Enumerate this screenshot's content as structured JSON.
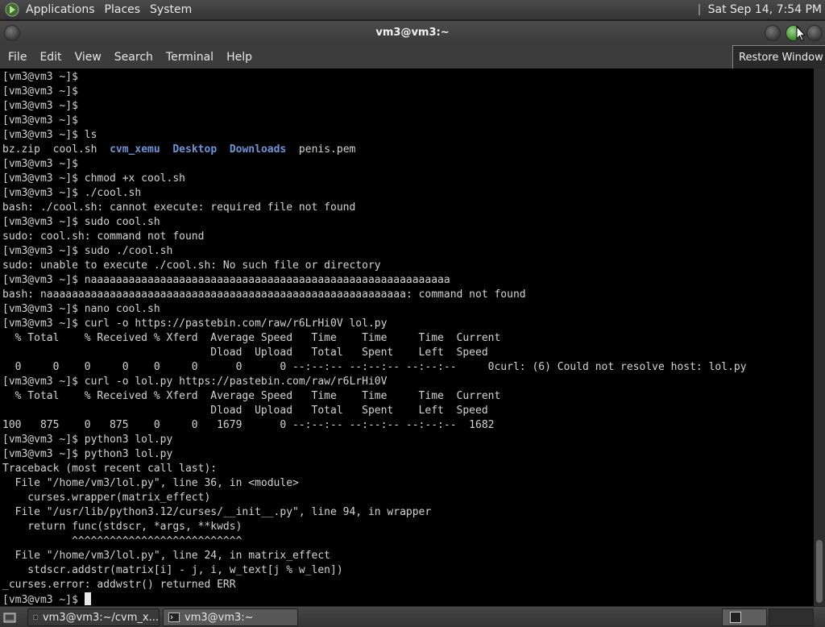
{
  "top_panel": {
    "menus": [
      "Applications",
      "Places",
      "System"
    ],
    "clock": "Sat Sep 14,  7:54 PM"
  },
  "window": {
    "title": "vm3@vm3:~",
    "tooltip": "Restore Window"
  },
  "menubar": [
    "File",
    "Edit",
    "View",
    "Search",
    "Terminal",
    "Help"
  ],
  "terminal": {
    "lines": [
      "[vm3@vm3 ~]$",
      "[vm3@vm3 ~]$",
      "[vm3@vm3 ~]$",
      "[vm3@vm3 ~]$",
      "[vm3@vm3 ~]$ ls",
      "__LS__",
      "[vm3@vm3 ~]$",
      "[vm3@vm3 ~]$ chmod +x cool.sh",
      "[vm3@vm3 ~]$ ./cool.sh",
      "bash: ./cool.sh: cannot execute: required file not found",
      "[vm3@vm3 ~]$ sudo cool.sh",
      "sudo: cool.sh: command not found",
      "[vm3@vm3 ~]$ sudo ./cool.sh",
      "sudo: unable to execute ./cool.sh: No such file or directory",
      "[vm3@vm3 ~]$ naaaaaaaaaaaaaaaaaaaaaaaaaaaaaaaaaaaaaaaaaaaaaaaaaaaaaaaaa",
      "bash: naaaaaaaaaaaaaaaaaaaaaaaaaaaaaaaaaaaaaaaaaaaaaaaaaaaaaaaaa: command not found",
      "[vm3@vm3 ~]$ nano cool.sh",
      "[vm3@vm3 ~]$ curl -o https://pastebin.com/raw/r6LrHi0V lol.py",
      "  % Total    % Received % Xferd  Average Speed   Time    Time     Time  Current",
      "                                 Dload  Upload   Total   Spent    Left  Speed",
      "  0     0    0     0    0     0      0      0 --:--:-- --:--:-- --:--:--     0curl: (6) Could not resolve host: lol.py",
      "[vm3@vm3 ~]$ curl -o lol.py https://pastebin.com/raw/r6LrHi0V",
      "  % Total    % Received % Xferd  Average Speed   Time    Time     Time  Current",
      "                                 Dload  Upload   Total   Spent    Left  Speed",
      "100   875    0   875    0     0   1679      0 --:--:-- --:--:-- --:--:--  1682",
      "[vm3@vm3 ~]$ python3 lol.py",
      "[vm3@vm3 ~]$ python3 lol.py",
      "Traceback (most recent call last):",
      "  File \"/home/vm3/lol.py\", line 36, in <module>",
      "    curses.wrapper(matrix_effect)",
      "  File \"/usr/lib/python3.12/curses/__init__.py\", line 94, in wrapper",
      "    return func(stdscr, *args, **kwds)",
      "           ^^^^^^^^^^^^^^^^^^^^^^^^^^^",
      "  File \"/home/vm3/lol.py\", line 24, in matrix_effect",
      "    stdscr.addstr(matrix[i] - j, i, w_text[j % w_len])",
      "_curses.error: addwstr() returned ERR"
    ],
    "ls_output": [
      {
        "text": "bz.zip",
        "dir": false
      },
      {
        "text": "cool.sh",
        "dir": false
      },
      {
        "text": "cvm_xemu",
        "dir": true
      },
      {
        "text": "Desktop",
        "dir": true
      },
      {
        "text": "Downloads",
        "dir": true
      },
      {
        "text": "penis.pem",
        "dir": false
      }
    ],
    "prompt": "[vm3@vm3 ~]$ ",
    "colors": {
      "directory": "#6b95d8",
      "text": "#d3d3d3",
      "background": "#000000"
    }
  },
  "taskbar": {
    "tasks": [
      {
        "label": "vm3@vm3:~/cvm_x...",
        "active": false
      },
      {
        "label": "vm3@vm3:~",
        "active": true
      }
    ]
  }
}
